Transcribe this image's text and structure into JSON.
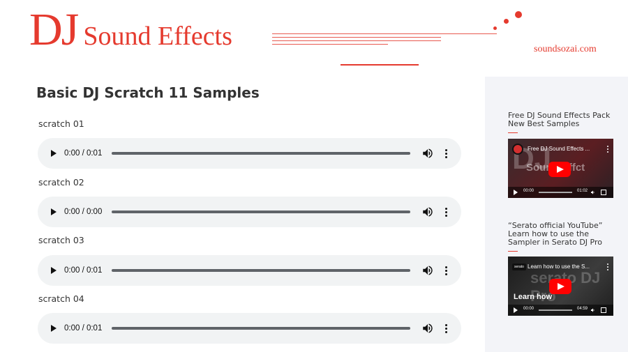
{
  "header": {
    "logo_dj": "DJ",
    "logo_rest": "Sound Effects",
    "site_url": "soundsozai.com",
    "accent": "#e53a2e"
  },
  "main": {
    "title": "Basic DJ Scratch 11 Samples",
    "samples": [
      {
        "label": "scratch 01",
        "time": "0:00 / 0:01"
      },
      {
        "label": "scratch 02",
        "time": "0:00 / 0:00"
      },
      {
        "label": "scratch 03",
        "time": "0:00 / 0:01"
      },
      {
        "label": "scratch 04",
        "time": "0:00 / 0:01"
      }
    ],
    "player_icons": [
      "play-icon",
      "volume-icon",
      "more-vert-icon"
    ]
  },
  "sidebar": {
    "items": [
      {
        "title_line1": "Free DJ Sound Effects Pack",
        "title_line2": "New Best Samples",
        "video": {
          "title": "Free DJ Sound Effects ...",
          "thumb_text_1": "DJ",
          "thumb_text_2": "Sound Effct",
          "current_time": "00:00",
          "duration": "01:02"
        }
      },
      {
        "title_line1": "“Serato official YouTube”",
        "title_line2": "Learn how to use the",
        "title_line3": "Sampler in Serato DJ Pro",
        "video": {
          "badge": "serato",
          "title": "Learn how to use the S...",
          "thumb_text_1": "serato DJ Pro",
          "caption": "Learn how",
          "current_time": "00:00",
          "duration": "04:59"
        }
      }
    ]
  }
}
